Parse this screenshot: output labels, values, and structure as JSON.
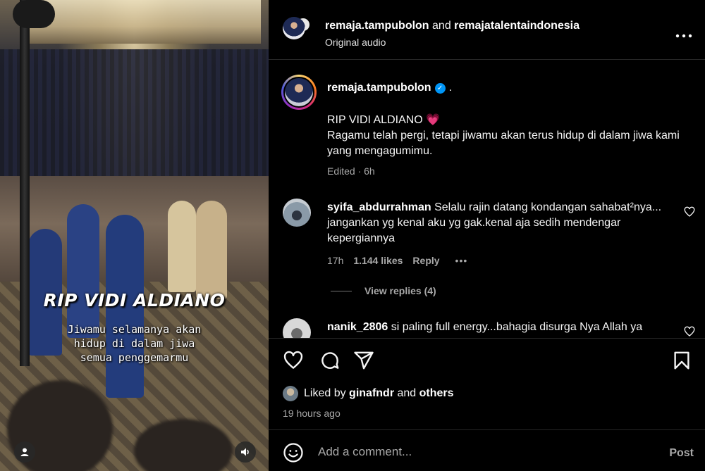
{
  "video": {
    "overlay_title": "RIP VIDI ALDIANO",
    "overlay_lines": [
      "Jiwamu selamanya akan",
      "hidup di dalam jiwa",
      "semua penggemarmu"
    ],
    "left_button_icon": "user-icon",
    "right_button_icon": "speaker-icon"
  },
  "header": {
    "author": "remaja.tampubolon",
    "connector": " and ",
    "collaborator": "remajatalentaindonesia",
    "audio": "Original audio",
    "more_icon": "more-horizontal-icon"
  },
  "caption": {
    "username": "remaja.tampubolon",
    "dot": ".",
    "line1": "RIP VIDI ALDIANO ",
    "line1_emoji": "💗",
    "line2": "Ragamu telah pergi, tetapi jiwamu akan terus hidup di dalam jiwa kami yang mengagumimu.",
    "meta": "Edited · 6h"
  },
  "comments": [
    {
      "username": "syifa_abdurrahman",
      "text": "Selalu rajin datang kondangan sahabat²nya... jangankan yg kenal aku yg gak.kenal aja sedih mendengar kepergiannya",
      "time": "17h",
      "likes": "1.144 likes",
      "reply": "Reply",
      "dots": "•••",
      "view_replies": "View replies (4)"
    },
    {
      "username": "nanik_2806",
      "text": "si paling full energy...bahagia disurga Nya Allah ya"
    }
  ],
  "actions": {
    "icons": [
      "heart-icon",
      "comment-icon",
      "share-icon",
      "bookmark-icon"
    ],
    "liked_prefix": "Liked by ",
    "liked_user": "ginafndr",
    "liked_mid": " and ",
    "liked_others": "others",
    "time_ago": "19 hours ago"
  },
  "add_comment": {
    "placeholder": "Add a comment...",
    "post_label": "Post"
  }
}
